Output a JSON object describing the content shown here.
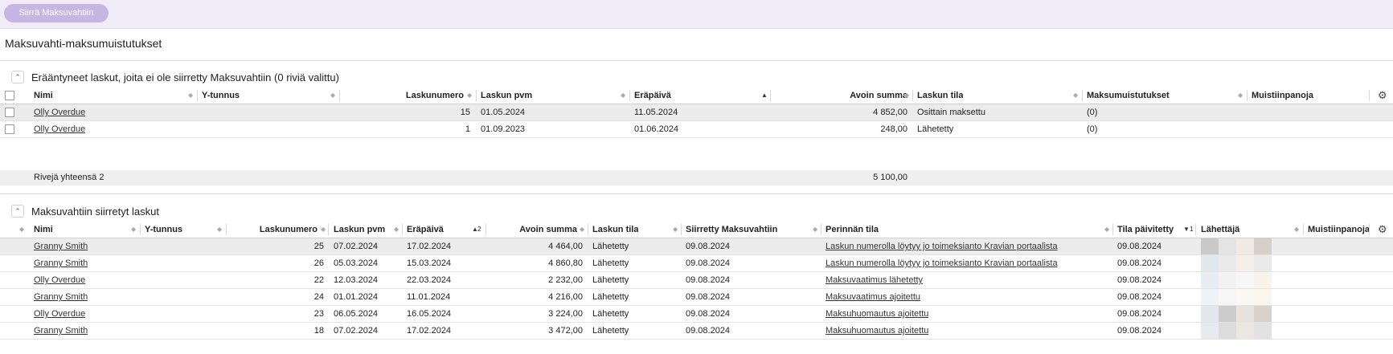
{
  "toolbar": {
    "transfer_label": "Siirrä Maksuvahtiin"
  },
  "page_title": "Maksuvahti-maksumuistutukset",
  "section1": {
    "title": "Erääntyneet laskut, joita ei ole siirretty Maksuvahtiin (0 riviä valittu)",
    "columns": [
      "Nimi",
      "Y-tunnus",
      "Laskunumero",
      "Laskun pvm",
      "Eräpäivä",
      "Avoin summa",
      "Laskun tila",
      "Maksumuistutukset",
      "Muistiinpanoja"
    ],
    "rows": [
      {
        "name": "Olly Overdue",
        "ytunnus": "",
        "number": "15",
        "invoice_date": "01.05.2024",
        "due_date": "11.05.2024",
        "open_sum": "4 852,00",
        "status": "Osittain maksettu",
        "reminders": "(0)",
        "notes": ""
      },
      {
        "name": "Olly Overdue",
        "ytunnus": "",
        "number": "1",
        "invoice_date": "01.09.2023",
        "due_date": "01.06.2024",
        "open_sum": "248,00",
        "status": "Lähetetty",
        "reminders": "(0)",
        "notes": ""
      }
    ],
    "totals_label": "Rivejä yhteensä 2",
    "totals_sum": "5 100,00"
  },
  "section2": {
    "title": "Maksuvahtiin siirretyt laskut",
    "columns": [
      "Nimi",
      "Y-tunnus",
      "Laskunumero",
      "Laskun pvm",
      "Eräpäivä",
      "Avoin summa",
      "Laskun tila",
      "Siirretty Maksuvahtiin",
      "Perinnän tila",
      "Tila päivitetty",
      "Lähettäjä",
      "Muistiinpanoja"
    ],
    "sort_marks": {
      "due_date": "2",
      "status_updated": "1"
    },
    "rows": [
      {
        "name": "Granny Smith",
        "number": "25",
        "invoice_date": "07.02.2024",
        "due_date": "17.02.2024",
        "open_sum": "4 464,00",
        "status": "Lähetetty",
        "transferred": "09.08.2024",
        "collection_status": "Laskun numerolla löytyy jo toimeksianto Kravian portaalista",
        "updated": "09.08.2024"
      },
      {
        "name": "Granny Smith",
        "number": "26",
        "invoice_date": "05.03.2024",
        "due_date": "15.03.2024",
        "open_sum": "4 860,80",
        "status": "Lähetetty",
        "transferred": "09.08.2024",
        "collection_status": "Laskun numerolla löytyy jo toimeksianto Kravian portaalista",
        "updated": "09.08.2024"
      },
      {
        "name": "Olly Overdue",
        "number": "22",
        "invoice_date": "12.03.2024",
        "due_date": "22.03.2024",
        "open_sum": "2 232,00",
        "status": "Lähetetty",
        "transferred": "09.08.2024",
        "collection_status": "Maksuvaatimus lähetetty",
        "updated": "09.08.2024"
      },
      {
        "name": "Granny Smith",
        "number": "24",
        "invoice_date": "01.01.2024",
        "due_date": "11.01.2024",
        "open_sum": "4 216,00",
        "status": "Lähetetty",
        "transferred": "09.08.2024",
        "collection_status": "Maksuvaatimus ajoitettu",
        "updated": "09.08.2024"
      },
      {
        "name": "Olly Overdue",
        "number": "23",
        "invoice_date": "06.05.2024",
        "due_date": "16.05.2024",
        "open_sum": "3 224,00",
        "status": "Lähetetty",
        "transferred": "09.08.2024",
        "collection_status": "Maksuhuomautus ajoitettu",
        "updated": "09.08.2024"
      },
      {
        "name": "Granny Smith",
        "number": "18",
        "invoice_date": "07.02.2024",
        "due_date": "17.02.2024",
        "open_sum": "3 472,00",
        "status": "Lähetetty",
        "transferred": "09.08.2024",
        "collection_status": "Maksuhuomautus ajoitettu",
        "updated": "09.08.2024"
      }
    ]
  },
  "icons": {
    "collapse": "chevron-up-icon",
    "settings": "gear-icon",
    "sort": "sort-arrows-icon"
  },
  "colors": {
    "topbar_bg": "#f1ebf8",
    "primary_button": "#c6b6e4",
    "selected_row": "#ececec"
  }
}
